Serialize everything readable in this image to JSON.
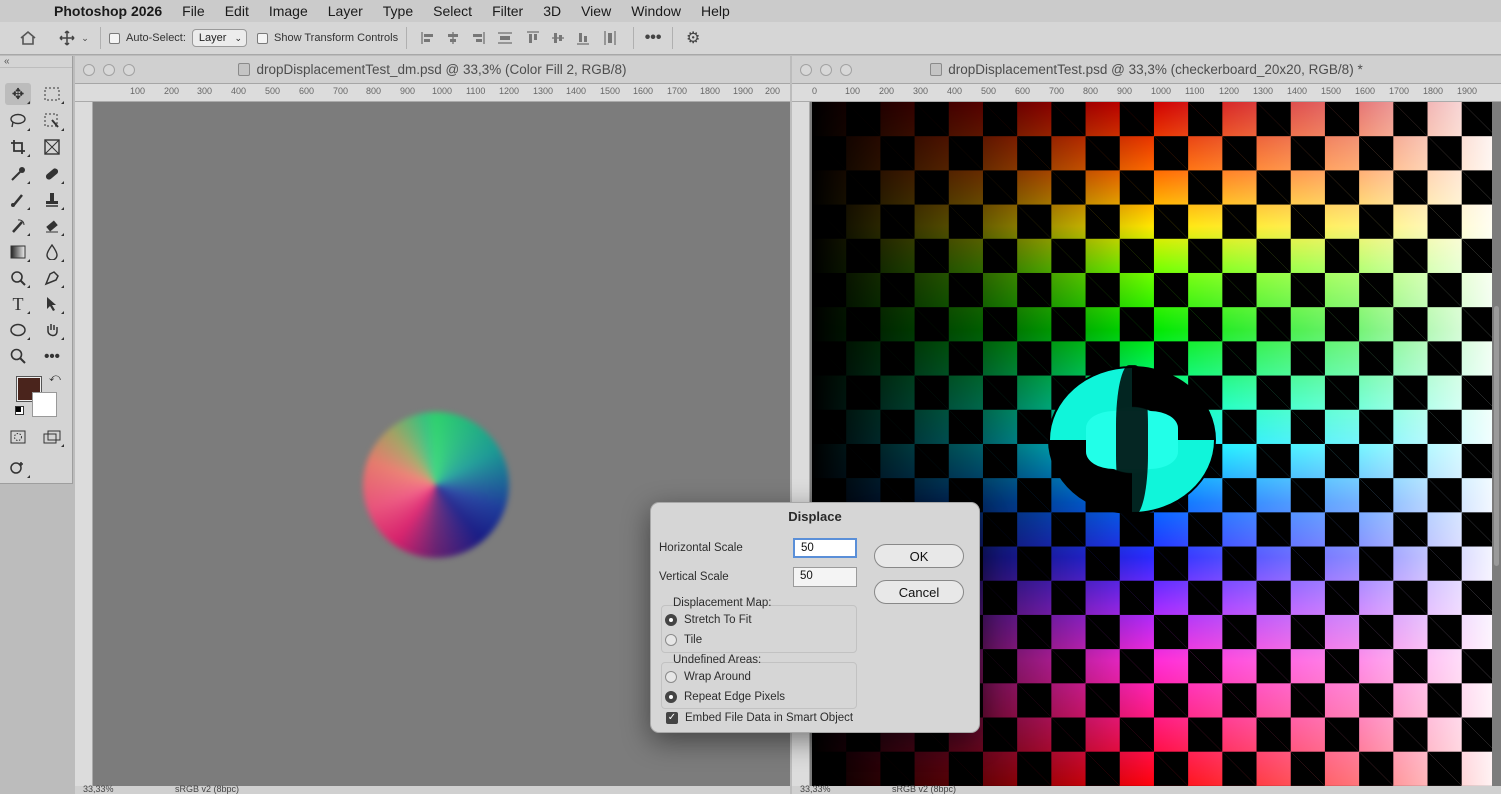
{
  "menubar": {
    "app_name": "Photoshop 2026",
    "items": [
      "File",
      "Edit",
      "Image",
      "Layer",
      "Type",
      "Select",
      "Filter",
      "3D",
      "View",
      "Window",
      "Help"
    ]
  },
  "options_bar": {
    "auto_select_label": "Auto-Select:",
    "auto_select_value": "Layer",
    "show_transform_label": "Show Transform Controls",
    "more_icon": "ellipsis-icon",
    "settings_icon": "gear-icon"
  },
  "tools": {
    "foreground_color": "#4a241c",
    "background_color": "#ffffff"
  },
  "doc_left": {
    "title": "dropDisplacementTest_dm.psd @ 33,3% (Color Fill 2, RGB/8)",
    "ruler_ticks": [
      "100",
      "200",
      "300",
      "400",
      "500",
      "600",
      "700",
      "800",
      "900",
      "1000",
      "1100",
      "1200",
      "1300",
      "1400",
      "1500",
      "1600",
      "1700",
      "1800",
      "1900",
      "200"
    ],
    "zoom": "33,33%",
    "profile": "sRGB v2 (8bpc)"
  },
  "doc_right": {
    "title": "dropDisplacementTest.psd @ 33,3% (checkerboard_20x20, RGB/8) *",
    "ruler_ticks": [
      "0",
      "100",
      "200",
      "300",
      "400",
      "500",
      "600",
      "700",
      "800",
      "900",
      "1000",
      "1100",
      "1200",
      "1300",
      "1400",
      "1500",
      "1600",
      "1700",
      "1800",
      "1900"
    ],
    "zoom": "33,33%",
    "profile": "sRGB v2 (8bpc)"
  },
  "dialog": {
    "title": "Displace",
    "horizontal_scale_label": "Horizontal Scale",
    "horizontal_scale_value": "50",
    "vertical_scale_label": "Vertical Scale",
    "vertical_scale_value": "50",
    "ok_label": "OK",
    "cancel_label": "Cancel",
    "displacement_map_label": "Displacement Map:",
    "stretch_label": "Stretch To Fit",
    "tile_label": "Tile",
    "undefined_areas_label": "Undefined Areas:",
    "wrap_label": "Wrap Around",
    "repeat_label": "Repeat Edge Pixels",
    "embed_label": "Embed File Data in Smart Object",
    "displacement_map_selected": "Stretch To Fit",
    "undefined_areas_selected": "Repeat Edge Pixels",
    "embed_checked": true
  }
}
